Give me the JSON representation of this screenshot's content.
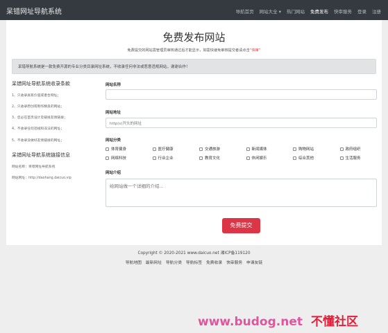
{
  "navbar": {
    "brand": "呆错网址导航系统",
    "items": [
      {
        "label": "导航首页",
        "active": false
      },
      {
        "label": "网站大全 ▾",
        "active": false
      },
      {
        "label": "热门网站",
        "active": false
      },
      {
        "label": "免费发布",
        "active": true
      },
      {
        "label": "快审服务",
        "active": false
      },
      {
        "label": "登录",
        "active": false
      },
      {
        "label": "注册",
        "active": false
      }
    ]
  },
  "main": {
    "title": "免费发布网站",
    "subtitle_prefix": "免费提交的网站需管理员审核通过后才能显示，如需快速免审核提交者请点击",
    "subtitle_link": "“快审”",
    "alert": "呆错导航系统是一款免费开源的专业分类目录网址系统，不收录任何非法或恶意违规网站，谢谢合作！"
  },
  "sidebar": {
    "terms_title": "呆错网址导航系统收录条款",
    "terms": [
      "1、只收录具有价值或者合网址；",
      "2、只收录原创或制作精良的网站；",
      "3、您必在首页设计及链接友情链接；",
      "4、不收录任何违规和非法的网址；",
      "5、不收录没做好友情链接的网址；"
    ],
    "links_title": "呆错网址导航系统链接信息",
    "links": [
      "网站名称：呆错网址导航系统",
      "网站网址：http://daohang.daicuo.vip"
    ]
  },
  "form": {
    "name_label": "网站名称",
    "name_value": "",
    "url_label": "网站地址",
    "url_placeholder": "http(s)开头的网址",
    "category_label": "网站分类",
    "categories": [
      "体育健身",
      "医疗健康",
      "交通旅游",
      "新闻媒体",
      "购物网站",
      "政府组织",
      "网络科技",
      "行业企业",
      "教育文化",
      "休闲娱乐",
      "综合其他",
      "生活服务"
    ],
    "intro_label": "网站介绍",
    "intro_placeholder": "给网站做一个详细的介绍...",
    "submit_label": "免费提交"
  },
  "footer": {
    "copyright": "Copyright © 2020-2021 www.daicuo.net 湘ICP备119120",
    "links": [
      "导航地图",
      "最新网址",
      "导航分类",
      "导航标签",
      "免费收录",
      "快审服务",
      "申请友链"
    ]
  },
  "watermark": {
    "url": "www.budog.net",
    "name": "不懂社区"
  }
}
